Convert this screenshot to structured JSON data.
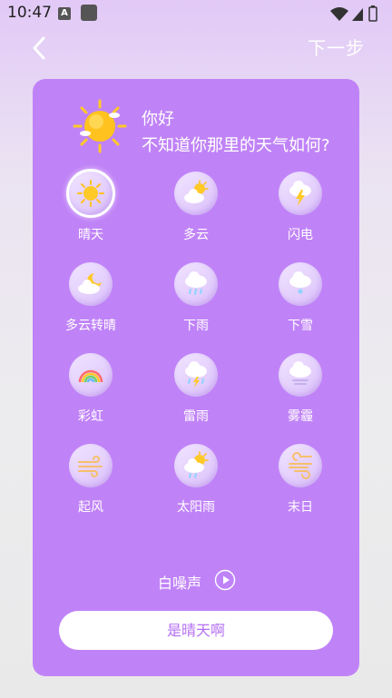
{
  "status_bar": {
    "time": "10:47",
    "notif_badge": "A"
  },
  "nav": {
    "next_label": "下一步"
  },
  "greeting": {
    "line1": "你好",
    "line2": "不知道你那里的天气如何?"
  },
  "weather_options": [
    {
      "label": "晴天",
      "icon": "sun-icon",
      "selected": true
    },
    {
      "label": "多云",
      "icon": "cloudy-sun-icon",
      "selected": false
    },
    {
      "label": "闪电",
      "icon": "lightning-icon",
      "selected": false
    },
    {
      "label": "多云转晴",
      "icon": "cloudy-to-clear-icon",
      "selected": false
    },
    {
      "label": "下雨",
      "icon": "rain-icon",
      "selected": false
    },
    {
      "label": "下雪",
      "icon": "snow-icon",
      "selected": false
    },
    {
      "label": "彩虹",
      "icon": "rainbow-icon",
      "selected": false
    },
    {
      "label": "雷雨",
      "icon": "thunderstorm-icon",
      "selected": false
    },
    {
      "label": "雾霾",
      "icon": "haze-icon",
      "selected": false
    },
    {
      "label": "起风",
      "icon": "wind-icon",
      "selected": false
    },
    {
      "label": "太阳雨",
      "icon": "sun-shower-icon",
      "selected": false
    },
    {
      "label": "末日",
      "icon": "doomsday-wind-icon",
      "selected": false
    }
  ],
  "white_noise": {
    "label": "白噪声"
  },
  "confirm": {
    "label": "是晴天啊"
  },
  "colors": {
    "card": "#c083f7",
    "accent_text": "#b56ff2",
    "sun": "#ffc928"
  }
}
